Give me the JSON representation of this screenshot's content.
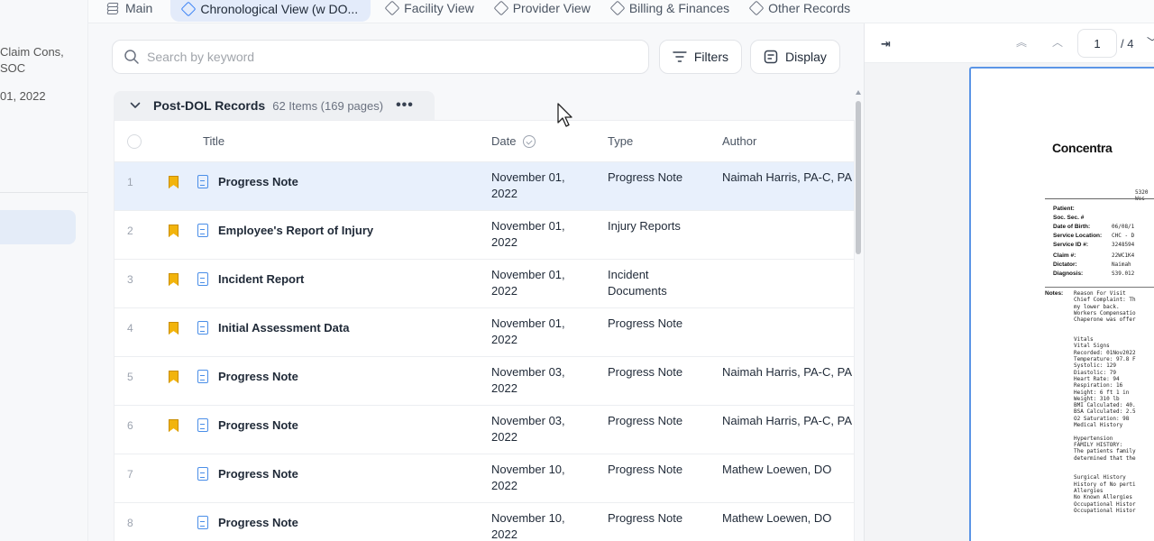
{
  "left_pane": {
    "line1": "Claim Cons,",
    "line2": "SOC",
    "line3": "01, 2022"
  },
  "tabs": [
    {
      "label": "Main",
      "icon": "layers-icon"
    },
    {
      "label": "Chronological View (w DO...",
      "icon": "diamond-icon"
    },
    {
      "label": "Facility View",
      "icon": "diamond-icon"
    },
    {
      "label": "Provider View",
      "icon": "diamond-icon"
    },
    {
      "label": "Billing & Finances",
      "icon": "diamond-icon"
    },
    {
      "label": "Other Records",
      "icon": "diamond-icon"
    }
  ],
  "toolbar": {
    "search_placeholder": "Search by keyword",
    "filters_label": "Filters",
    "display_label": "Display"
  },
  "group": {
    "title": "Post-DOL Records",
    "count": "62 Items (169 pages)",
    "more": "•••"
  },
  "table": {
    "columns": {
      "title": "Title",
      "date": "Date",
      "type": "Type",
      "author": "Author"
    },
    "rows": [
      {
        "num": "1",
        "bookmarked": true,
        "title": "Progress Note",
        "date_line1": "November 01,",
        "date_line2": "2022",
        "type_line1": "Progress Note",
        "type_line2": "",
        "author": "Naimah Harris, PA-C, PA"
      },
      {
        "num": "2",
        "bookmarked": true,
        "title": "Employee's Report of Injury",
        "date_line1": "November 01,",
        "date_line2": "2022",
        "type_line1": "Injury Reports",
        "type_line2": "",
        "author": ""
      },
      {
        "num": "3",
        "bookmarked": true,
        "title": "Incident Report",
        "date_line1": "November 01,",
        "date_line2": "2022",
        "type_line1": "Incident",
        "type_line2": "Documents",
        "author": ""
      },
      {
        "num": "4",
        "bookmarked": true,
        "title": "Initial Assessment Data",
        "date_line1": "November 01,",
        "date_line2": "2022",
        "type_line1": "Progress Note",
        "type_line2": "",
        "author": ""
      },
      {
        "num": "5",
        "bookmarked": true,
        "title": "Progress Note",
        "date_line1": "November 03,",
        "date_line2": "2022",
        "type_line1": "Progress Note",
        "type_line2": "",
        "author": "Naimah Harris, PA-C, PA"
      },
      {
        "num": "6",
        "bookmarked": true,
        "title": "Progress Note",
        "date_line1": "November 03,",
        "date_line2": "2022",
        "type_line1": "Progress Note",
        "type_line2": "",
        "author": "Naimah Harris, PA-C, PA"
      },
      {
        "num": "7",
        "bookmarked": false,
        "title": "Progress Note",
        "date_line1": "November 10,",
        "date_line2": "2022",
        "type_line1": "Progress Note",
        "type_line2": "",
        "author": "Mathew Loewen, DO"
      },
      {
        "num": "8",
        "bookmarked": false,
        "title": "Progress Note",
        "date_line1": "November 10,",
        "date_line2": "2022",
        "type_line1": "Progress Note",
        "type_line2": "",
        "author": "Mathew Loewen, DO"
      }
    ]
  },
  "viewer": {
    "current_page": "1",
    "total_pages": "/ 4",
    "doc": {
      "brand": "Concentra",
      "address": "5320 Wes",
      "fields": [
        {
          "label": "Patient:",
          "value": ""
        },
        {
          "label": "Soc. Sec. #",
          "value": ""
        },
        {
          "label": "Date of Birth:",
          "value": "06/08/1"
        },
        {
          "label": "Service Location:",
          "value": "CHC - D"
        },
        {
          "label": "Service ID #:",
          "value": "3248594"
        },
        {
          "label": "Claim #:",
          "value": "22WC1K4"
        },
        {
          "label": "Dictator:",
          "value": "Naimah"
        },
        {
          "label": "Diagnosis:",
          "value": "S39.012"
        }
      ],
      "notes_label": "Notes:",
      "notes_lines": [
        "Reason For Visit",
        "Chief Complaint: Th",
        "my lower back.",
        "Workers Compensatio",
        "Chaperone was offer",
        "",
        "",
        "Vitals",
        "Vital Signs",
        "Recorded: 01Nov2022",
        "Temperature: 97.8 F",
        "Systolic: 129",
        "Diastolic: 79",
        "Heart Rate: 94",
        "Respiration: 16",
        "Height: 6 ft 1 in",
        "Weight: 310 lb",
        "BMI Calculated: 40.",
        "BSA Calculated: 2.5",
        "O2 Saturation: 98",
        "Medical History",
        "",
        "Hypertension",
        "FAMILY HISTORY:",
        "The patients family",
        "determined that the",
        "",
        "",
        "Surgical History",
        "History of No perti",
        "Allergies",
        "No Known Allergies",
        "Occupational Histor",
        "Occupational Histor"
      ]
    }
  },
  "colors": {
    "accent": "#3b82f6",
    "selected_row": "#e8f0fc",
    "bookmark": "#f2b40c",
    "doc_icon": "#4a8ee8"
  }
}
